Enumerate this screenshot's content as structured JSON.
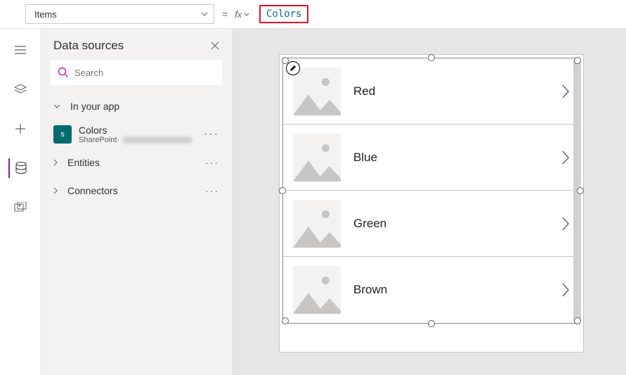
{
  "formula_bar": {
    "property": "Items",
    "formula": "Colors"
  },
  "panel": {
    "title": "Data sources",
    "search_placeholder": "Search",
    "sections": {
      "in_app": "In your app",
      "entities": "Entities",
      "connectors": "Connectors"
    },
    "datasources": [
      {
        "name": "Colors",
        "connector": "SharePoint",
        "icon_initials": "s"
      }
    ]
  },
  "gallery": {
    "items": [
      {
        "label": "Red"
      },
      {
        "label": "Blue"
      },
      {
        "label": "Green"
      },
      {
        "label": "Brown"
      }
    ]
  }
}
